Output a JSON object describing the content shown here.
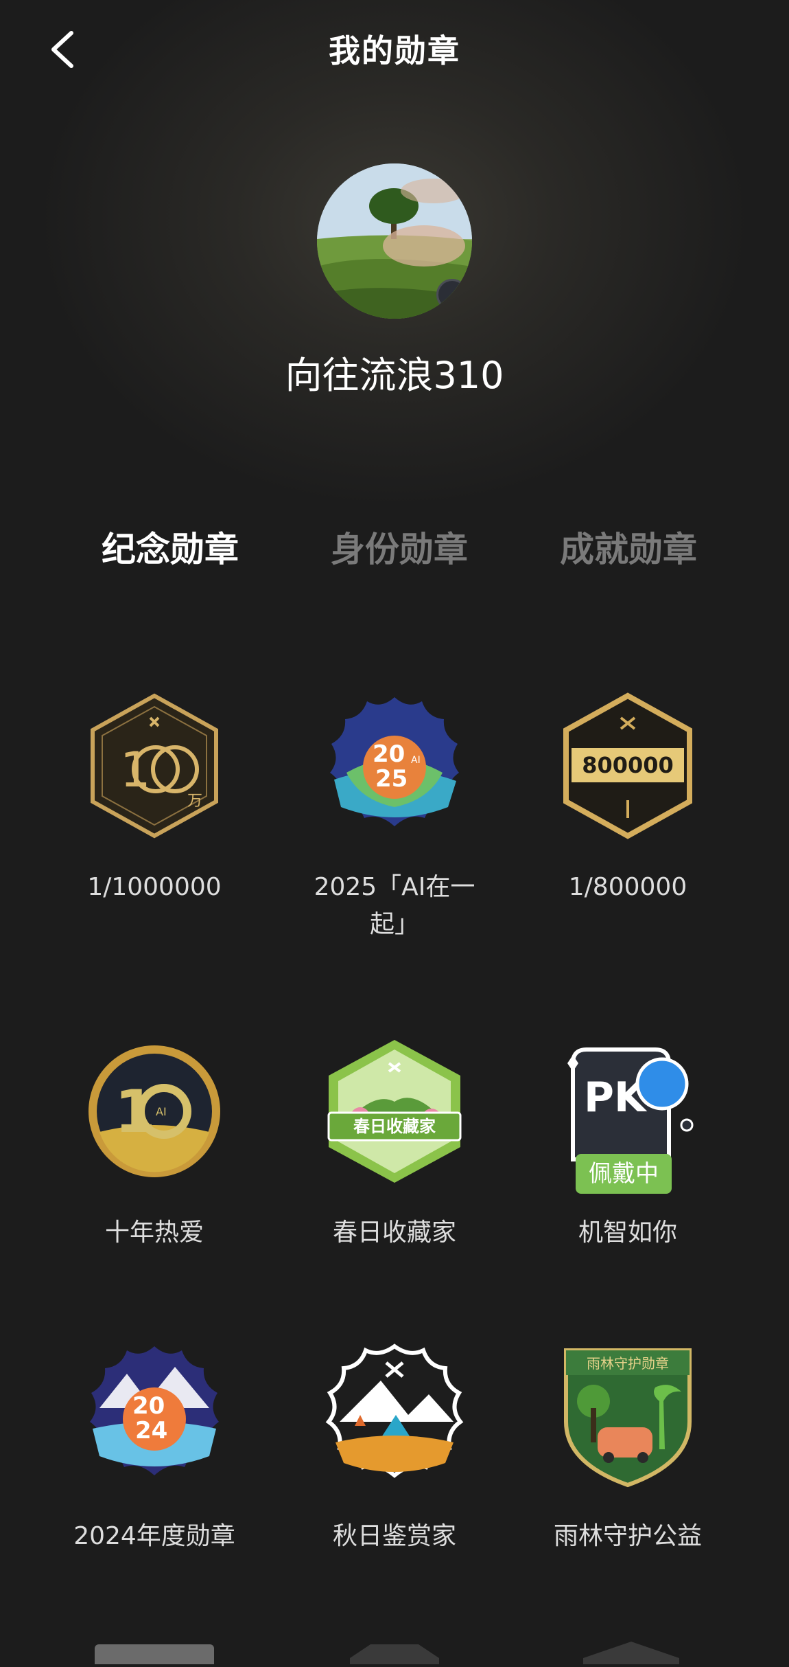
{
  "header": {
    "title": "我的勋章",
    "back_icon": "chevron-left-icon"
  },
  "profile": {
    "username": "向往流浪310"
  },
  "tabs": [
    {
      "label": "纪念勋章",
      "active": true
    },
    {
      "label": "身份勋章",
      "active": false
    },
    {
      "label": "成就勋章",
      "active": false
    }
  ],
  "medals": [
    {
      "label": "1/1000000",
      "icon": "100-wan-gold-hexagon-icon"
    },
    {
      "label": "2025「AI在一起」",
      "icon": "2025-ai-flower-badge-icon"
    },
    {
      "label": "1/800000",
      "icon": "800000-gold-hexagon-icon"
    },
    {
      "label": "十年热爱",
      "icon": "10-years-gold-coin-icon"
    },
    {
      "label": "春日收藏家",
      "icon": "spring-collector-green-hexagon-icon",
      "banner": "春日收藏家"
    },
    {
      "label": "机智如你",
      "icon": "pk-robot-bulb-icon",
      "badge": "佩戴中"
    },
    {
      "label": "2024年度勋章",
      "icon": "2024-annual-flower-badge-icon"
    },
    {
      "label": "秋日鉴赏家",
      "icon": "autumn-connoisseur-tent-icon"
    },
    {
      "label": "雨林守护公益",
      "icon": "rainforest-guardian-shield-icon",
      "banner": "雨林守护勋章"
    }
  ],
  "colors": {
    "background": "#1c1c1c",
    "active_tab": "#ffffff",
    "inactive_tab": "#7a7a7a",
    "wearing_badge": "#7cc152"
  }
}
